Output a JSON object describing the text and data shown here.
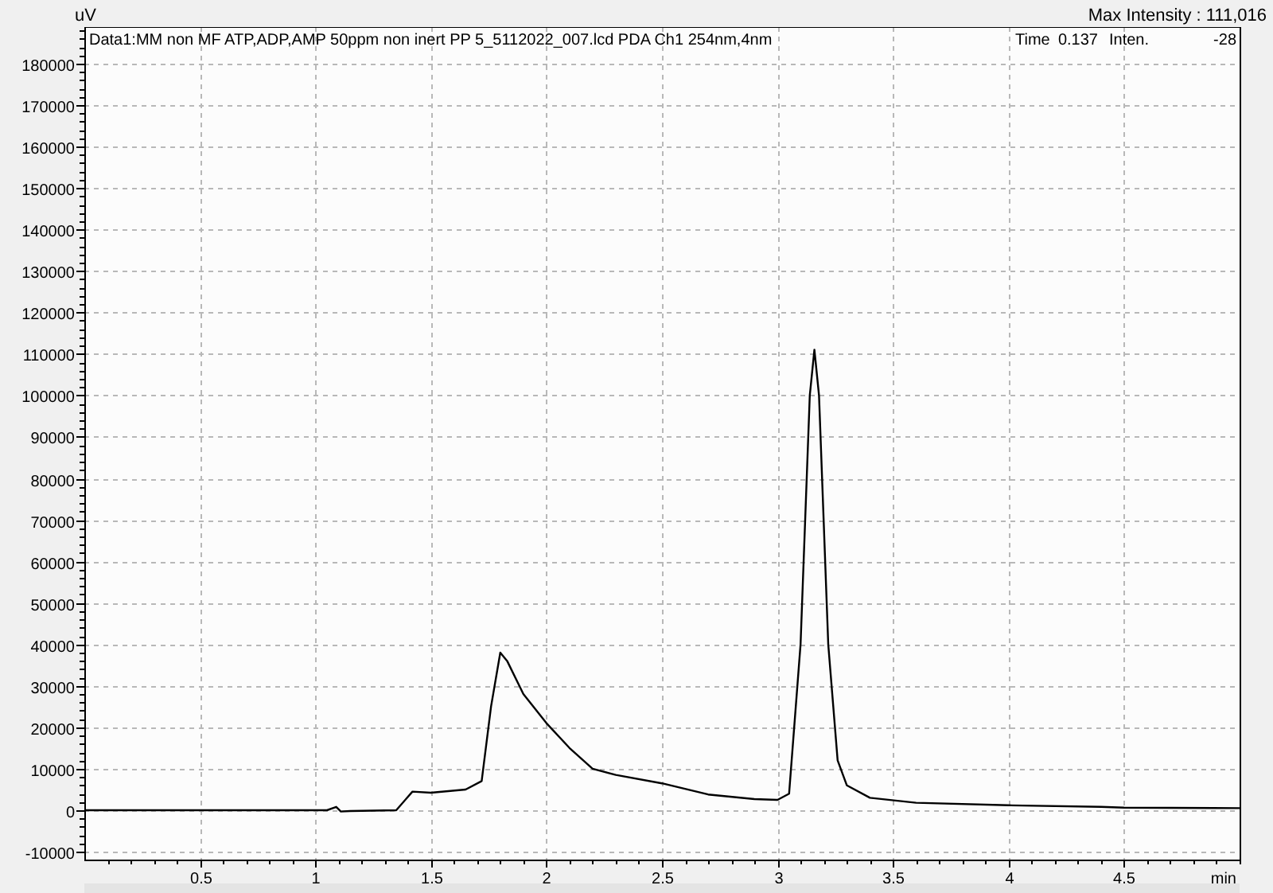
{
  "header": {
    "max_intensity": "Max Intensity : 111,016"
  },
  "chart": {
    "data_title": "Data1:MM  non MF ATP,ADP,AMP 50ppm non inert PP 5_5112022_007.lcd PDA Ch1 254nm,4nm",
    "cursor": {
      "time_label": "Time",
      "time_value": "0.137",
      "intensity_label": "Inten.",
      "intensity_value": "-28"
    },
    "chart_data": {
      "type": "line",
      "xlabel": "min",
      "ylabel": "uV",
      "x": [
        0,
        1.05,
        1.09,
        1.11,
        1.15,
        1.35,
        1.42,
        1.5,
        1.65,
        1.72,
        1.76,
        1.8,
        1.83,
        1.9,
        2.0,
        2.1,
        2.2,
        2.3,
        2.5,
        2.7,
        2.9,
        3.0,
        3.05,
        3.1,
        3.14,
        3.16,
        3.18,
        3.22,
        3.26,
        3.3,
        3.4,
        3.6,
        4.0,
        4.4,
        4.5,
        5.0
      ],
      "series": [
        {
          "color": "#000000",
          "values": [
            0,
            0,
            800,
            -300,
            -200,
            0,
            4500,
            4200,
            5000,
            7000,
            25000,
            38000,
            36000,
            28000,
            21000,
            15000,
            10000,
            8500,
            6500,
            3800,
            2700,
            2500,
            4000,
            40000,
            100000,
            111000,
            100000,
            40000,
            12000,
            6000,
            3000,
            1800,
            1200,
            800,
            600,
            500
          ]
        }
      ],
      "grid": true,
      "xlim": [
        0,
        5
      ],
      "ylim": [
        -11900,
        188800
      ],
      "xticks": [
        0.5,
        1.0,
        1.5,
        2.0,
        2.5,
        3.0,
        3.5,
        4.0,
        4.5
      ],
      "yticks": [
        -10000,
        0,
        10000,
        20000,
        30000,
        40000,
        50000,
        60000,
        70000,
        80000,
        90000,
        100000,
        110000,
        120000,
        130000,
        140000,
        150000,
        160000,
        170000,
        180000
      ]
    }
  }
}
